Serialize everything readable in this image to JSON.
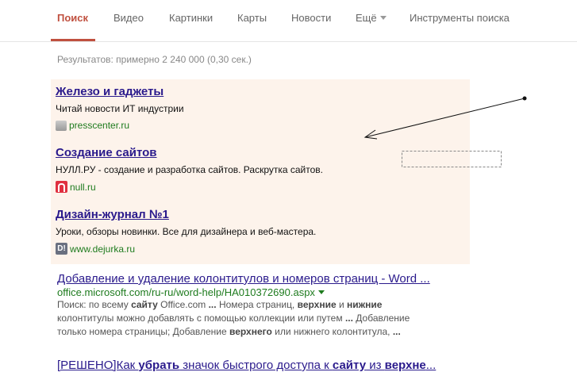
{
  "tabs": [
    {
      "label": "Поиск"
    },
    {
      "label": "Видео"
    },
    {
      "label": "Картинки"
    },
    {
      "label": "Карты"
    },
    {
      "label": "Новости"
    },
    {
      "label": "Ещё"
    },
    {
      "label": "Инструменты поиска"
    }
  ],
  "stats": "Результатов: примерно 2 240 000 (0,30 сек.)",
  "ads": [
    {
      "title": "Железо и гаджеты",
      "desc": "Читай новости ИТ индустрии",
      "url": "presscenter.ru"
    },
    {
      "title": "Создание сайтов",
      "desc": "НУЛЛ.РУ - создание и разработка сайтов. Раскрутка сайтов.",
      "url": "null.ru"
    },
    {
      "title": "Дизайн-журнал №1",
      "desc": "Уроки, обзоры новинки. Все для дизайнера и веб-мастера.",
      "url": "www.dejurka.ru"
    }
  ],
  "results": [
    {
      "title": "Добавление и удаление колонтитулов и номеров страниц - Word ...",
      "url": "office.microsoft.com/ru-ru/word-help/HA010372690.aspx",
      "snippet": [
        {
          "t": "Поиск: по всему "
        },
        {
          "t": "сайту",
          "b": true
        },
        {
          "t": " Office.com "
        },
        {
          "t": "...",
          "b": true
        },
        {
          "t": " Номера страниц, "
        },
        {
          "t": "верхние",
          "b": true
        },
        {
          "t": " и "
        },
        {
          "t": "нижние",
          "b": true
        },
        {
          "t": " колонтитулы можно добавлять с помощью коллекции или путем "
        },
        {
          "t": "...",
          "b": true
        },
        {
          "t": " Добавление только номера страницы; Добавление "
        },
        {
          "t": "верхнего",
          "b": true
        },
        {
          "t": " или нижнего колонтитула, "
        },
        {
          "t": "...",
          "b": true
        }
      ]
    },
    {
      "title_parts": [
        {
          "t": "[РЕШЕНО]Как "
        },
        {
          "t": "убрать",
          "b": true
        },
        {
          "t": " значок быстрого доступа к "
        },
        {
          "t": "сайту",
          "b": true
        },
        {
          "t": " из "
        },
        {
          "t": "верхне",
          "b": true
        },
        {
          "t": "..."
        }
      ]
    }
  ],
  "colors": {
    "accent": "#c0503f",
    "link": "#2a1a8c",
    "url": "#1e7b1e",
    "ad_bg": "#fdf3eb"
  }
}
